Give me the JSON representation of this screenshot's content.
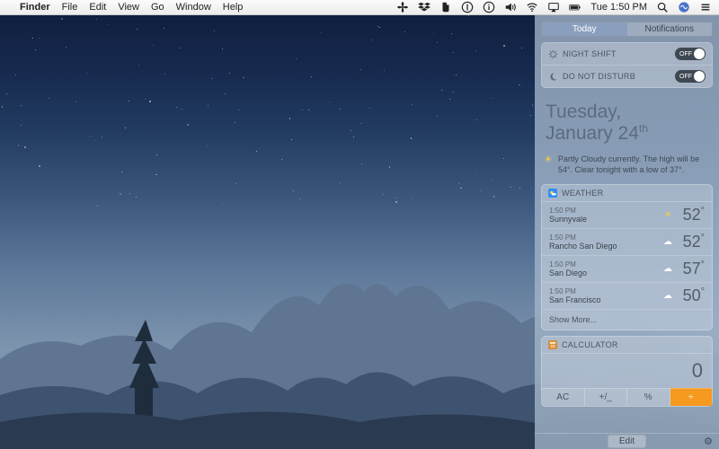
{
  "menubar": {
    "app": "Finder",
    "items": [
      "File",
      "Edit",
      "View",
      "Go",
      "Window",
      "Help"
    ],
    "clock": "Tue 1:50 PM",
    "status_icons": [
      "fan-icon",
      "dropbox-icon",
      "evernote-icon",
      "onepassword-icon",
      "circle-i-icon",
      "volume-icon",
      "wifi-icon",
      "airplay-icon",
      "battery-icon"
    ],
    "tail_icons": [
      "spotlight-icon",
      "siri-icon",
      "notification-center-icon"
    ]
  },
  "panel": {
    "tabs": {
      "today": "Today",
      "notifications": "Notifications",
      "active": "today"
    },
    "toggles": {
      "night_shift": {
        "label": "NIGHT SHIFT",
        "off": "OFF"
      },
      "dnd": {
        "label": "DO NOT DISTURB",
        "off": "OFF"
      }
    },
    "date": {
      "line1": "Tuesday,",
      "line2_prefix": "January 24",
      "line2_suffix": "th"
    },
    "summary": "Partly Cloudy currently. The high will be 54°. Clear tonight with a low of 37°.",
    "weather": {
      "title": "WEATHER",
      "rows": [
        {
          "time": "1:50 PM",
          "city": "Sunnyvale",
          "icon": "sun",
          "temp": "52"
        },
        {
          "time": "1:50 PM",
          "city": "Rancho San Diego",
          "icon": "cloud",
          "temp": "52"
        },
        {
          "time": "1:50 PM",
          "city": "San Diego",
          "icon": "cloud",
          "temp": "57"
        },
        {
          "time": "1:50 PM",
          "city": "San Francisco",
          "icon": "cloud",
          "temp": "50"
        }
      ],
      "show_more": "Show More..."
    },
    "calculator": {
      "title": "CALCULATOR",
      "display": "0",
      "keys": [
        "AC",
        "+/_",
        "%",
        "÷"
      ]
    },
    "footer": {
      "edit": "Edit"
    }
  }
}
